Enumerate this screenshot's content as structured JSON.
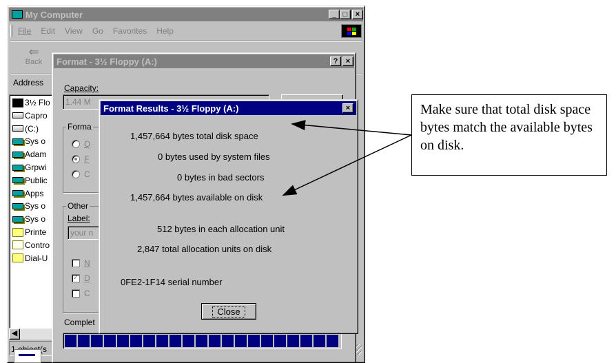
{
  "my_computer": {
    "title": "My Computer",
    "menu": [
      "File",
      "Edit",
      "View",
      "Go",
      "Favorites",
      "Help"
    ],
    "back_label": "Back",
    "address_label": "Address",
    "status_text": "1 object(s",
    "tree": [
      "3½ Flo",
      "Capro",
      "(C:)",
      "Sys o",
      "Adam",
      "Grpwi",
      "Public",
      "Apps",
      "Sys o",
      "Sys o",
      "Printe",
      "Contro",
      "Dial-U"
    ],
    "tree_icons": [
      "disk-icon",
      "capro-icon",
      "drive-icon",
      "network-drive-icon",
      "network-drive-icon",
      "network-drive-icon",
      "network-drive-icon",
      "network-drive-icon",
      "network-drive-icon",
      "network-drive-icon",
      "printers-folder-icon",
      "control-panel-icon",
      "dial-up-folder-icon"
    ]
  },
  "format_dialog": {
    "title": "Format - 3½ Floppy (A:)",
    "capacity_label": "Capacity:",
    "capacity_value": "1.44 M",
    "format_type_label": "Forma",
    "radio_labels": [
      "Q",
      "F",
      "C"
    ],
    "other_label": "Other",
    "label_label": "Label:",
    "label_placeholder": "your n",
    "checkbox_labels": [
      "N",
      "D",
      "C"
    ],
    "complete_label": "Complet",
    "progress_percent": 100
  },
  "results_dialog": {
    "title": "Format Results - 3½ Floppy (A:)",
    "lines": [
      "1,457,664 bytes total disk space",
      "0 bytes used by system files",
      "0 bytes in bad sectors",
      "1,457,664 bytes available on disk",
      "512 bytes in each allocation unit",
      "2,847 total allocation units on disk",
      "0FE2-1F14 serial number"
    ],
    "close_label": "Close"
  },
  "callout": {
    "text": "Make sure that total disk space bytes match the available bytes on disk."
  }
}
